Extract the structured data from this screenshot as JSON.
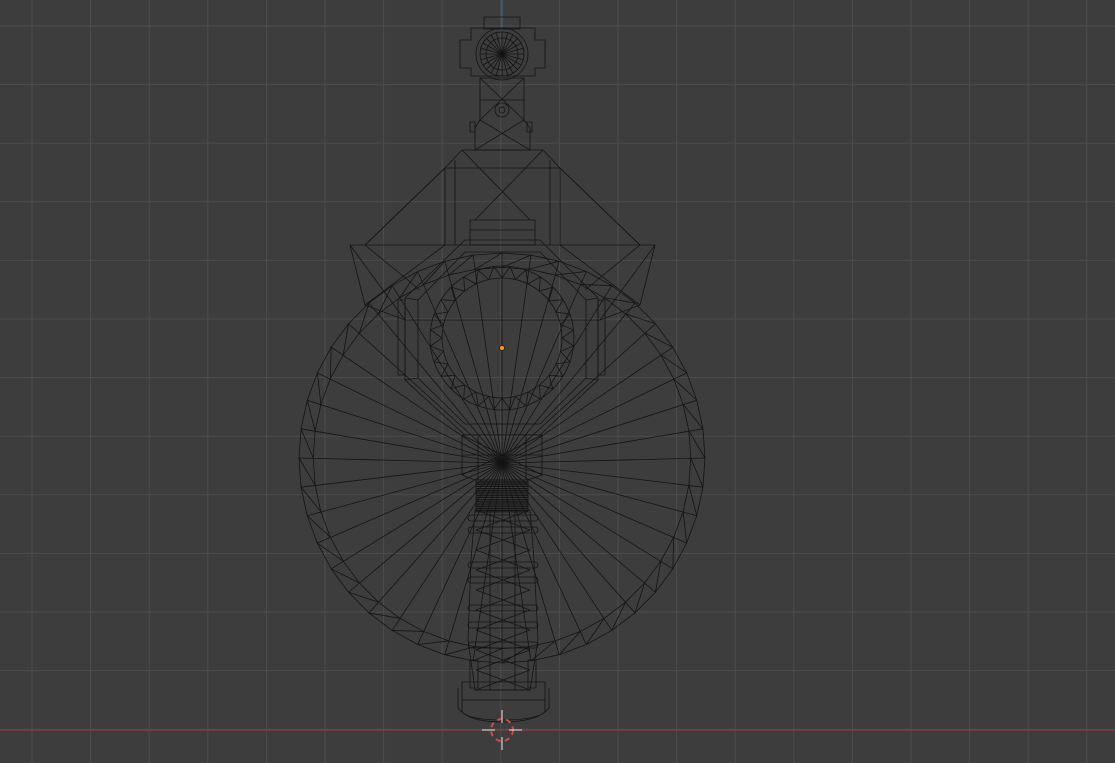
{
  "viewport": {
    "view": "wireframe",
    "colors": {
      "background": "#3d3d3d",
      "grid_line": "#4d4d4d",
      "x_axis": "#8f3b3b",
      "y_axis": "#3d6a96",
      "wire": "#141414",
      "origin": "#ff8c1a",
      "cursor_red": "#d24a4a",
      "cursor_white": "#e6e6e6"
    },
    "icons": {
      "cursor": "3d-cursor-icon",
      "origin": "object-origin-icon"
    }
  }
}
